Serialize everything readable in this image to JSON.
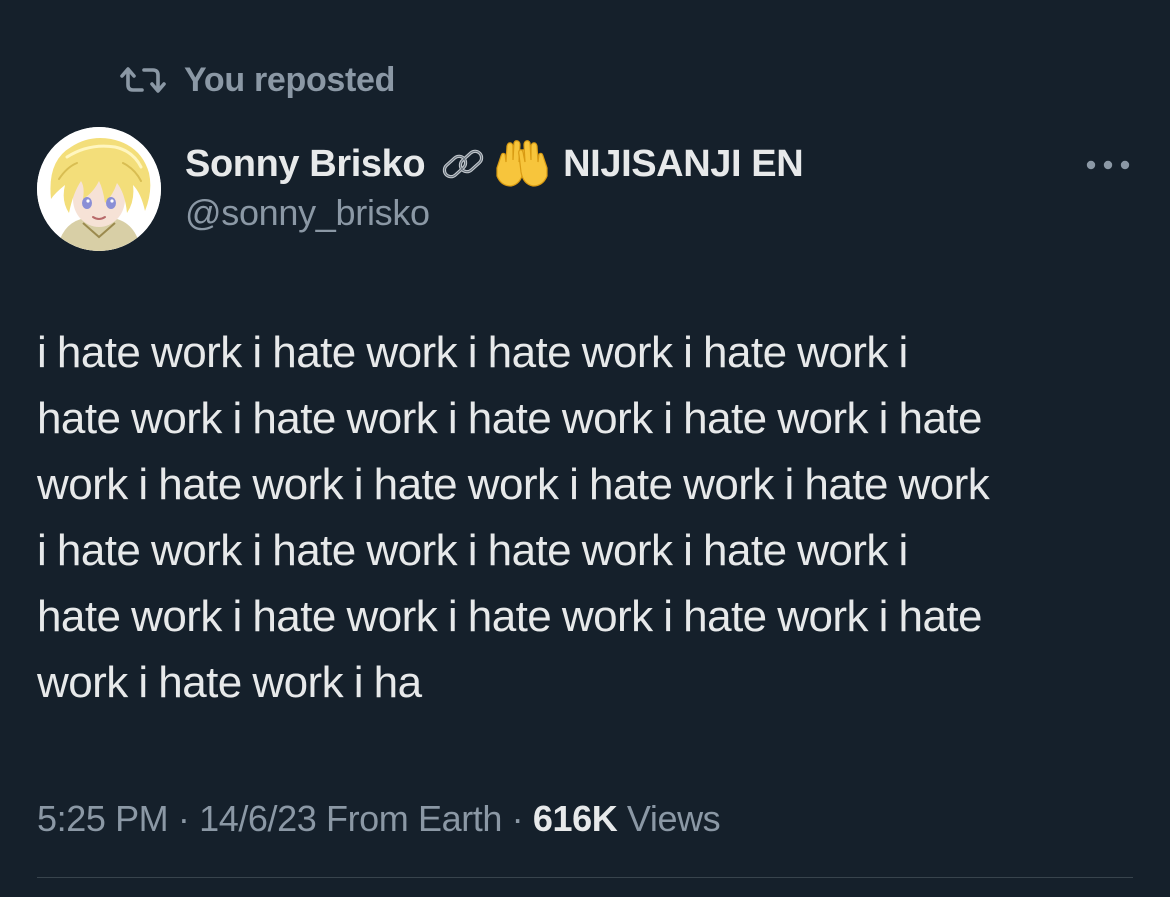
{
  "repost": {
    "icon": "repost-icon",
    "label": "You reposted"
  },
  "author": {
    "avatar_icon": "avatar",
    "display_name": "Sonny Brisko",
    "badge_icons": [
      "link-icon",
      "raised-hands-icon"
    ],
    "affiliation": "NIJISANJI EN",
    "handle": "@sonny_brisko"
  },
  "menu": {
    "more_icon": "more-options-icon"
  },
  "tweet": {
    "lines": [
      "i hate work i hate work i hate work i hate work i",
      "hate work i hate work i hate work i hate work i hate",
      "work i hate work i hate work i hate work i hate work",
      "i hate work i hate work i hate work i hate work i",
      "hate work i hate work i hate work i hate work i hate",
      "work i hate work i ha"
    ]
  },
  "meta": {
    "time": "5:25 PM",
    "separator": " · ",
    "date": "14/6/23",
    "source": " From Earth",
    "view_count": "616K",
    "views_label": " Views"
  },
  "colors": {
    "background": "#15202b",
    "primary_text": "#e7e9ea",
    "secondary_text": "#8b98a5",
    "divider": "#38444d"
  }
}
